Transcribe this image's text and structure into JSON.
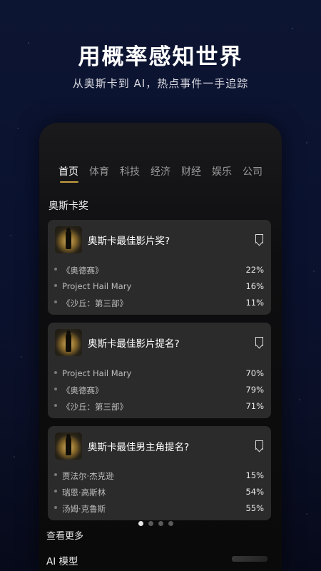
{
  "hero": {
    "title": "用概率感知世界",
    "subtitle": "从奥斯卡到 AI，热点事件一手追踪"
  },
  "tabs": [
    {
      "label": "首页",
      "active": true
    },
    {
      "label": "体育"
    },
    {
      "label": "科技"
    },
    {
      "label": "经济"
    },
    {
      "label": "财经"
    },
    {
      "label": "娱乐"
    },
    {
      "label": "公司"
    }
  ],
  "section": {
    "title": "奥斯卡奖"
  },
  "cards": [
    {
      "question": "奥斯卡最佳影片奖?",
      "options": [
        {
          "label": "《奥德赛》",
          "pct": "22%"
        },
        {
          "label": "Project Hail Mary",
          "pct": "16%"
        },
        {
          "label": "《沙丘：第三部》",
          "pct": "11%"
        }
      ]
    },
    {
      "question": "奥斯卡最佳影片提名?",
      "options": [
        {
          "label": "Project Hail Mary",
          "pct": "70%"
        },
        {
          "label": "《奥德赛》",
          "pct": "79%"
        },
        {
          "label": "《沙丘：第三部》",
          "pct": "71%"
        }
      ]
    },
    {
      "question": "奥斯卡最佳男主角提名?",
      "options": [
        {
          "label": "贾法尔·杰克逊",
          "pct": "15%"
        },
        {
          "label": "瑞恩·高斯林",
          "pct": "54%"
        },
        {
          "label": "汤姆·克鲁斯",
          "pct": "55%"
        }
      ]
    }
  ],
  "pager": {
    "count": 4,
    "active": 1
  },
  "more_label": "查看更多",
  "ai_section": {
    "title": "AI 模型"
  },
  "colors": {
    "accent": "#c9a043",
    "card": "#2b2b2b",
    "bg": "#0a1230"
  }
}
